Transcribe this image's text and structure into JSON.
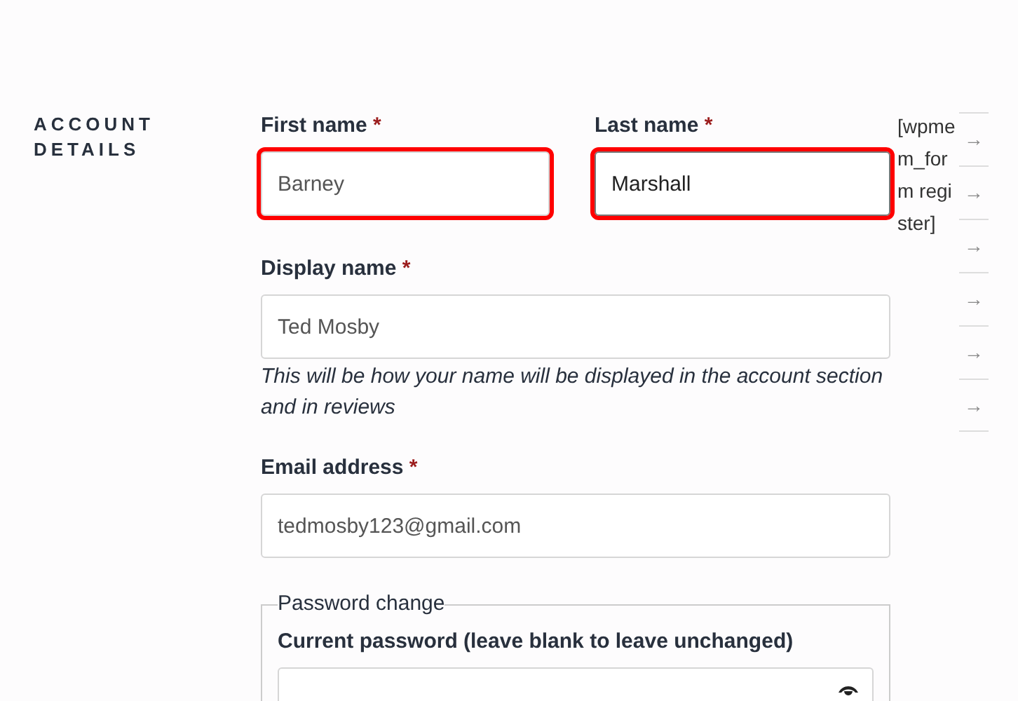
{
  "section_title": "ACCOUNT DETAILS",
  "name_fields": [
    {
      "label": "First name",
      "required_mark": "*",
      "value": "Barney",
      "highlighted": true,
      "focused": false
    },
    {
      "label": "Last name",
      "required_mark": "*",
      "value": "Marshall",
      "highlighted": true,
      "focused": true
    }
  ],
  "shortcode": "[wpmem_form register]",
  "display_name": {
    "label": "Display name",
    "required_mark": "*",
    "value": "Ted Mosby",
    "description": "This will be how your name will be displayed in the account section and in reviews"
  },
  "email": {
    "label": "Email address",
    "required_mark": "*",
    "value": "tedmosby123@gmail.com"
  },
  "password_change": {
    "legend": "Password change",
    "current_password": {
      "label": "Current password (leave blank to leave unchanged)"
    }
  },
  "side_links": [
    "→",
    "→",
    "→",
    "→",
    "→",
    "→"
  ]
}
